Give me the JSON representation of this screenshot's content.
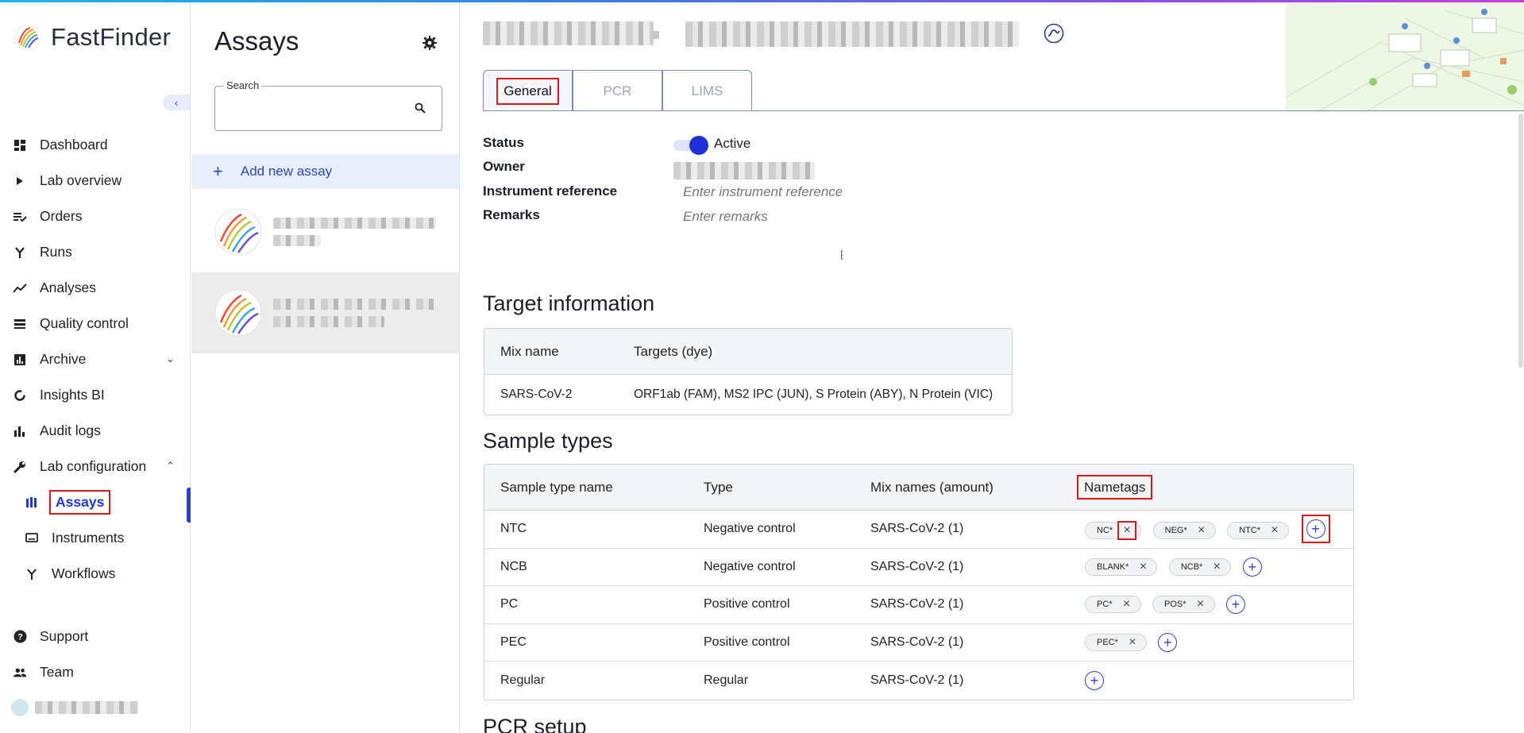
{
  "app": {
    "name": "FastFinder"
  },
  "sidebar": {
    "collapse_icon": "chevron-left-icon",
    "items": [
      {
        "label": "Dashboard",
        "icon": "dashboard-icon"
      },
      {
        "label": "Lab overview",
        "icon": "play-icon"
      },
      {
        "label": "Orders",
        "icon": "orders-icon"
      },
      {
        "label": "Runs",
        "icon": "fork-icon"
      },
      {
        "label": "Analyses",
        "icon": "trend-icon"
      },
      {
        "label": "Quality control",
        "icon": "stack-icon"
      },
      {
        "label": "Archive",
        "icon": "bar-chart-icon"
      },
      {
        "label": "Insights BI",
        "icon": "donut-icon"
      },
      {
        "label": "Audit logs",
        "icon": "bars-icon"
      },
      {
        "label": "Lab configuration",
        "icon": "wrench-icon"
      }
    ],
    "sub_items": [
      {
        "label": "Assays",
        "icon": "assays-icon"
      },
      {
        "label": "Instruments",
        "icon": "monitor-icon"
      },
      {
        "label": "Workflows",
        "icon": "workflow-icon"
      }
    ],
    "bottom": [
      {
        "label": "Support",
        "icon": "help-icon"
      },
      {
        "label": "Team",
        "icon": "team-icon"
      }
    ]
  },
  "assays": {
    "title": "Assays",
    "search": {
      "label": "Search",
      "value": "",
      "placeholder": ""
    },
    "add_label": "Add new assay"
  },
  "main": {
    "tabs": [
      "General",
      "PCR",
      "LIMS"
    ],
    "general": {
      "status_label": "Status",
      "status_value": "Active",
      "owner_label": "Owner",
      "instrument_label": "Instrument reference",
      "instrument_placeholder": "Enter instrument reference",
      "remarks_label": "Remarks",
      "remarks_placeholder": "Enter remarks"
    },
    "target_info": {
      "title": "Target information",
      "columns": [
        "Mix name",
        "Targets (dye)"
      ],
      "rows": [
        [
          "SARS-CoV-2",
          "ORF1ab (FAM), MS2 IPC (JUN), S Protein (ABY), N Protein (VIC)"
        ]
      ]
    },
    "sample_types": {
      "title": "Sample types",
      "columns": [
        "Sample type name",
        "Type",
        "Mix names (amount)",
        "Nametags"
      ],
      "rows": [
        {
          "name": "NTC",
          "type": "Negative control",
          "mix": "SARS-CoV-2 (1)",
          "tags": [
            "NC*",
            "NEG*",
            "NTC*"
          ]
        },
        {
          "name": "NCB",
          "type": "Negative control",
          "mix": "SARS-CoV-2 (1)",
          "tags": [
            "BLANK*",
            "NCB*"
          ]
        },
        {
          "name": "PC",
          "type": "Positive control",
          "mix": "SARS-CoV-2 (1)",
          "tags": [
            "PC*",
            "POS*"
          ]
        },
        {
          "name": "PEC",
          "type": "Positive control",
          "mix": "SARS-CoV-2 (1)",
          "tags": [
            "PEC*"
          ]
        },
        {
          "name": "Regular",
          "type": "Regular",
          "mix": "SARS-CoV-2 (1)",
          "tags": []
        }
      ]
    },
    "pcr_setup_title": "PCR setup"
  }
}
